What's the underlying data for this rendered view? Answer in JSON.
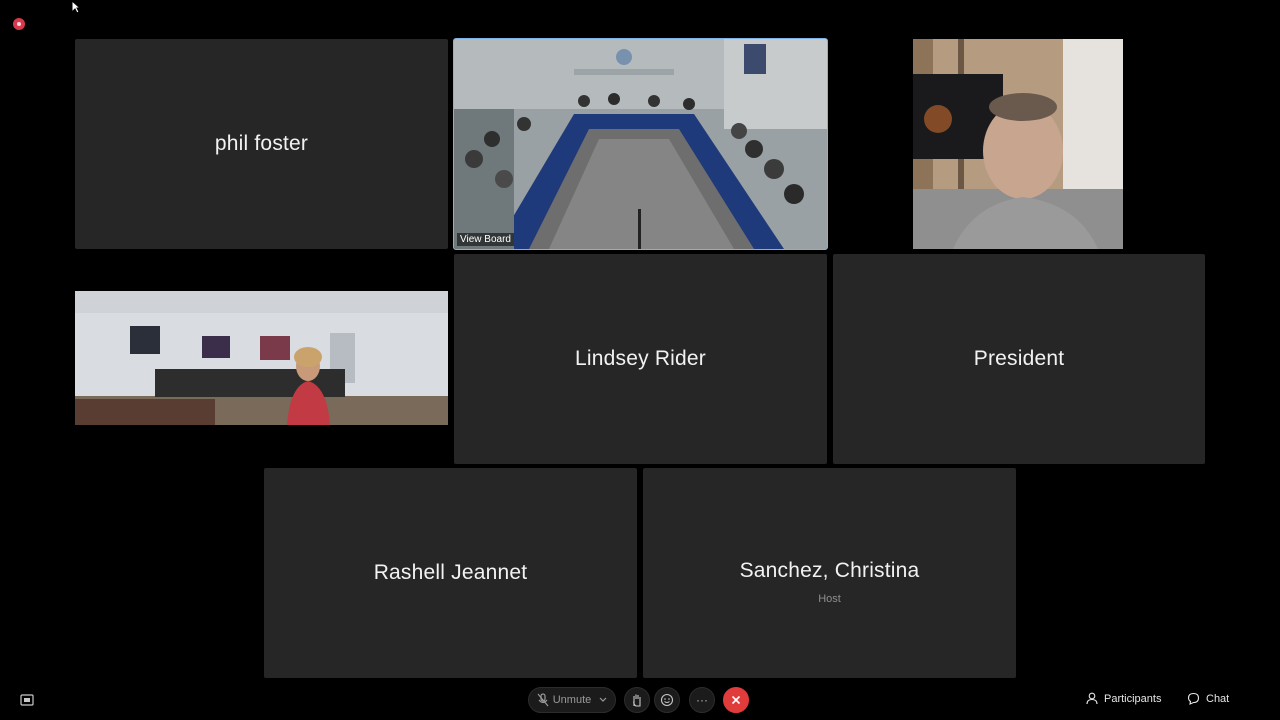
{
  "tiles": {
    "phil": {
      "name": "phil foster"
    },
    "board": {
      "label": "View Board"
    },
    "lindsey": {
      "name": "Lindsey Rider"
    },
    "president": {
      "name": "President"
    },
    "rashell": {
      "name": "Rashell Jeannet"
    },
    "sanchez": {
      "name": "Sanchez, Christina",
      "role": "Host"
    }
  },
  "toolbar": {
    "unmute_label": "Unmute",
    "more_label": "···",
    "participants_label": "Participants",
    "chat_label": "Chat"
  },
  "colors": {
    "tile_bg": "#262626",
    "active_border": "#7fb2e5",
    "leave_red": "#e03c3c",
    "recording_red": "#d9394e"
  },
  "icons": [
    "recording-indicator-icon",
    "mouse-cursor-icon",
    "layout-icon",
    "microphone-muted-icon",
    "chevron-down-icon",
    "raise-hand-icon",
    "emoji-icon",
    "more-icon",
    "leave-icon",
    "participants-icon",
    "chat-icon"
  ]
}
